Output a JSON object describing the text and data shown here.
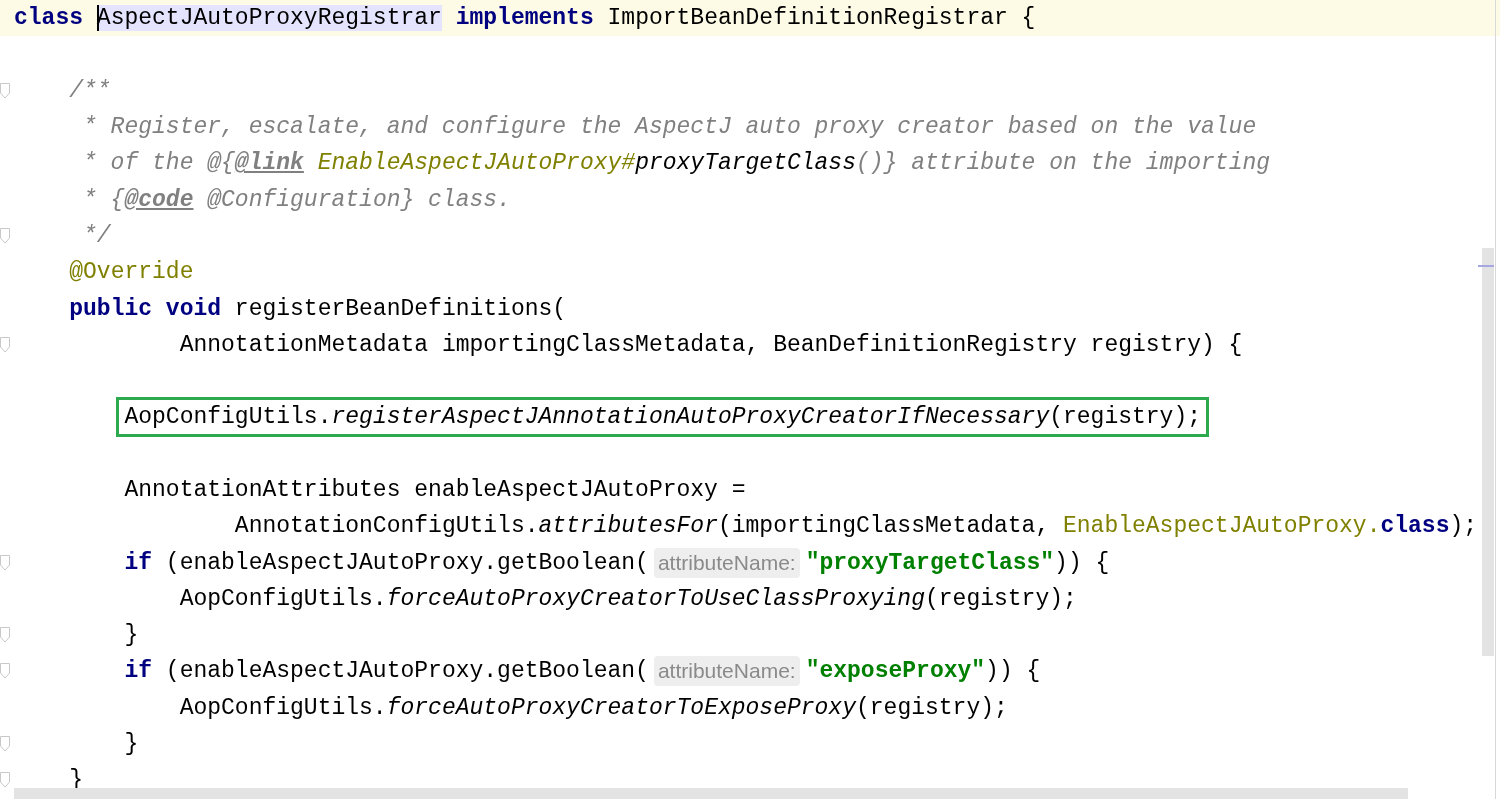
{
  "editor": {
    "lines": [
      {
        "fold": false,
        "current": true,
        "boxed": false,
        "tokens": [
          {
            "kind": "keyword",
            "text": "class "
          },
          {
            "kind": "usage",
            "text": "AspectJAutoProxyRegistrar",
            "caret": true
          },
          {
            "kind": "keyword",
            "text": " implements"
          },
          {
            "kind": "plain",
            "text": " ImportBeanDefinitionRegistrar {"
          }
        ]
      },
      {
        "fold": false,
        "current": false
      },
      {
        "fold": true,
        "current": false,
        "boxed": false,
        "tokens": [
          {
            "kind": "comment",
            "text": "    /**"
          }
        ]
      },
      {
        "fold": false,
        "current": false,
        "boxed": false,
        "tokens": [
          {
            "kind": "comment",
            "text": "     * Register, escalate, and configure the AspectJ auto proxy creator based on the value"
          }
        ]
      },
      {
        "fold": false,
        "current": false,
        "boxed": false,
        "tokens": [
          {
            "kind": "comment",
            "text": "     * of the @{"
          },
          {
            "kind": "doc-tag",
            "text": "@link"
          },
          {
            "kind": "doc-ref",
            "text": " EnableAspectJAutoProxy#"
          },
          {
            "kind": "doc-member",
            "text": "proxyTargetClass"
          },
          {
            "kind": "comment",
            "text": "()} attribute on the importing"
          }
        ]
      },
      {
        "fold": false,
        "current": false,
        "boxed": false,
        "tokens": [
          {
            "kind": "comment",
            "text": "     * {"
          },
          {
            "kind": "doc-tag",
            "text": "@code"
          },
          {
            "kind": "comment",
            "text": " @Configuration} class."
          }
        ]
      },
      {
        "fold": true,
        "current": false,
        "boxed": false,
        "tokens": [
          {
            "kind": "comment",
            "text": "     */"
          }
        ]
      },
      {
        "fold": false,
        "current": false,
        "boxed": false,
        "tokens": [
          {
            "kind": "annotation",
            "text": "    @Override"
          }
        ]
      },
      {
        "fold": false,
        "current": false,
        "boxed": false,
        "tokens": [
          {
            "kind": "keyword",
            "text": "    public void"
          },
          {
            "kind": "plain",
            "text": " registerBeanDefinitions("
          }
        ]
      },
      {
        "fold": true,
        "current": false,
        "boxed": false,
        "tokens": [
          {
            "kind": "plain",
            "text": "            AnnotationMetadata importingClassMetadata, BeanDefinitionRegistry registry) {"
          }
        ]
      },
      {
        "fold": false,
        "current": false
      },
      {
        "fold": false,
        "current": false,
        "boxed": true,
        "tokens": [
          {
            "kind": "plain",
            "text": "        AopConfigUtils."
          },
          {
            "kind": "static-call",
            "text": "registerAspectJAnnotationAutoProxyCreatorIfNecessary"
          },
          {
            "kind": "plain",
            "text": "(registry);"
          }
        ]
      },
      {
        "fold": false,
        "current": false
      },
      {
        "fold": false,
        "current": false,
        "boxed": false,
        "tokens": [
          {
            "kind": "plain",
            "text": "        AnnotationAttributes enableAspectJAutoProxy ="
          }
        ]
      },
      {
        "fold": false,
        "current": false,
        "boxed": false,
        "tokens": [
          {
            "kind": "plain",
            "text": "                AnnotationConfigUtils."
          },
          {
            "kind": "static-call",
            "text": "attributesFor"
          },
          {
            "kind": "plain",
            "text": "(importingClassMetadata, "
          },
          {
            "kind": "class-ref",
            "text": "EnableAspectJAutoProxy."
          },
          {
            "kind": "keyword",
            "text": "class"
          },
          {
            "kind": "plain",
            "text": ");"
          }
        ]
      },
      {
        "fold": true,
        "current": false,
        "boxed": false,
        "tokens": [
          {
            "kind": "keyword",
            "text": "        if"
          },
          {
            "kind": "plain",
            "text": " (enableAspectJAutoProxy.getBoolean("
          },
          {
            "kind": "hint",
            "text": "attributeName:"
          },
          {
            "kind": "string",
            "text": "\"proxyTargetClass\""
          },
          {
            "kind": "plain",
            "text": ")) {"
          }
        ]
      },
      {
        "fold": false,
        "current": false,
        "boxed": false,
        "tokens": [
          {
            "kind": "plain",
            "text": "            AopConfigUtils."
          },
          {
            "kind": "static-call",
            "text": "forceAutoProxyCreatorToUseClassProxying"
          },
          {
            "kind": "plain",
            "text": "(registry);"
          }
        ]
      },
      {
        "fold": true,
        "current": false,
        "boxed": false,
        "tokens": [
          {
            "kind": "plain",
            "text": "        }"
          }
        ]
      },
      {
        "fold": true,
        "current": false,
        "boxed": false,
        "tokens": [
          {
            "kind": "keyword",
            "text": "        if"
          },
          {
            "kind": "plain",
            "text": " (enableAspectJAutoProxy.getBoolean("
          },
          {
            "kind": "hint",
            "text": "attributeName:"
          },
          {
            "kind": "string",
            "text": "\"exposeProxy\""
          },
          {
            "kind": "plain",
            "text": ")) {"
          }
        ]
      },
      {
        "fold": false,
        "current": false,
        "boxed": false,
        "tokens": [
          {
            "kind": "plain",
            "text": "            AopConfigUtils."
          },
          {
            "kind": "static-call",
            "text": "forceAutoProxyCreatorToExposeProxy"
          },
          {
            "kind": "plain",
            "text": "(registry);"
          }
        ]
      },
      {
        "fold": true,
        "current": false,
        "boxed": false,
        "tokens": [
          {
            "kind": "plain",
            "text": "        }"
          }
        ]
      },
      {
        "fold": true,
        "current": false,
        "boxed": false,
        "tokens": [
          {
            "kind": "plain",
            "text": "    }"
          }
        ]
      }
    ]
  }
}
